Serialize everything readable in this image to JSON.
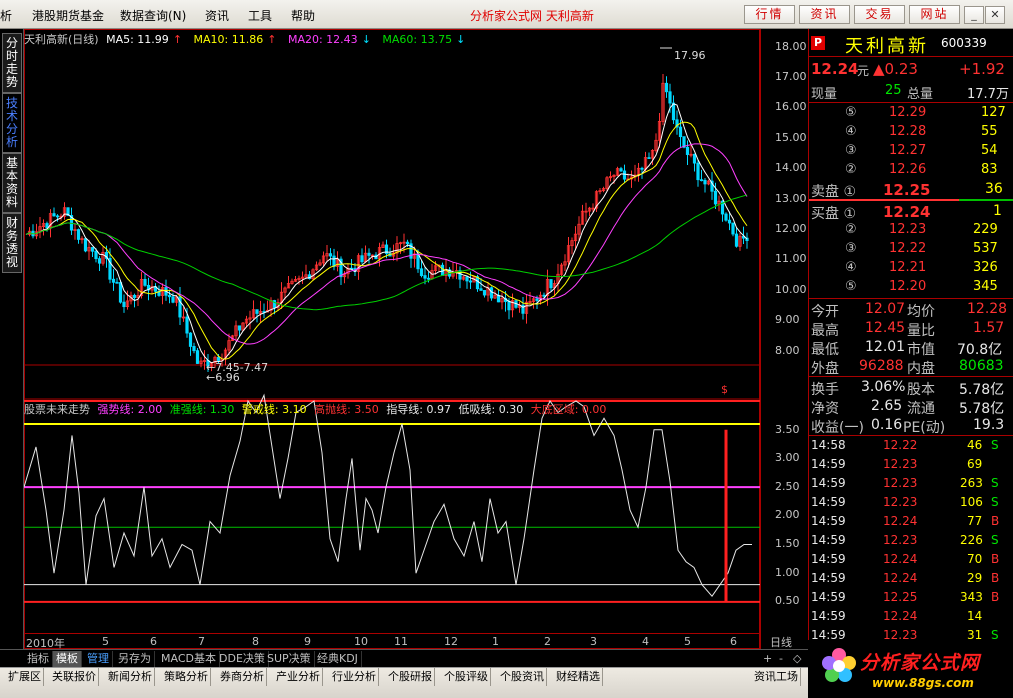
{
  "menu": {
    "items": [
      "析",
      "港股期货基金",
      "数据查询(N)",
      "资讯",
      "工具",
      "帮助"
    ],
    "center_title": "分析家公式网  天利高新",
    "right_buttons": [
      "行情",
      "资讯",
      "交易",
      "网站"
    ],
    "window_buttons": [
      "_",
      "▭",
      "✕"
    ]
  },
  "left_tabs": [
    {
      "label": "分时走势",
      "active": false
    },
    {
      "label": "技术分析",
      "active": true
    },
    {
      "label": "基本资料",
      "active": false
    },
    {
      "label": "财务透视",
      "active": false
    }
  ],
  "main_chart": {
    "title": "天利高新(日线)",
    "ma": [
      {
        "label": "MA5: 11.99",
        "arrow": "↑",
        "color": "#ffffff",
        "arrow_color": "#ff3232"
      },
      {
        "label": "MA10: 11.86",
        "arrow": "↑",
        "color": "#ffff00",
        "arrow_color": "#ff3232"
      },
      {
        "label": "MA20: 12.43",
        "arrow": "↓",
        "color": "#ff40ff",
        "arrow_color": "#00e0ff"
      },
      {
        "label": "MA60: 13.75",
        "arrow": "↓",
        "color": "#00e000",
        "arrow_color": "#00e0ff"
      }
    ],
    "annotations": {
      "high": "17.96",
      "low": "6.96",
      "range": "7.45-7.47"
    },
    "yaxis_ticks": [
      "18.00",
      "17.00",
      "16.00",
      "15.00",
      "14.00",
      "13.00",
      "12.00",
      "11.00",
      "10.00",
      "9.00",
      "8.00"
    ]
  },
  "indicator": {
    "title": "股票未来走势",
    "lines": [
      {
        "label": "强势线: 2.00",
        "color": "#ff40ff"
      },
      {
        "label": "准强线: 1.30",
        "color": "#00e000"
      },
      {
        "label": "警戒线: 3.10",
        "color": "#ffff00"
      },
      {
        "label": "高抛线: 3.50",
        "color": "#ff3232"
      },
      {
        "label": "指导线: 0.97",
        "color": "#e8e8e8"
      },
      {
        "label": "低吸线: 0.30",
        "color": "#e8e8e8"
      },
      {
        "label": "大底区域: 0.00",
        "color": "#ff3232"
      }
    ],
    "yaxis_ticks": [
      "3.50",
      "3.00",
      "2.50",
      "2.00",
      "1.50",
      "1.00",
      "0.50"
    ]
  },
  "xaxis": {
    "labels": [
      "2010年",
      "5",
      "6",
      "7",
      "8",
      "9",
      "10",
      "11",
      "12",
      "1",
      "2",
      "3",
      "4",
      "5",
      "6"
    ],
    "period": "日线"
  },
  "bottom_tabs": [
    {
      "label": "指标",
      "style": "normal"
    },
    {
      "label": "模板",
      "style": "active"
    },
    {
      "label": "管理",
      "style": "blue"
    },
    {
      "label": "另存为",
      "style": "normal"
    },
    {
      "label": "MACD基本",
      "style": "normal"
    },
    {
      "label": "DDE决策",
      "style": "normal"
    },
    {
      "label": "SUP决策",
      "style": "normal"
    },
    {
      "label": "经典KDJ",
      "style": "normal"
    }
  ],
  "status_tabs": [
    "扩展区",
    "关联报价",
    "新闻分析",
    "策略分析",
    "券商分析",
    "产业分析",
    "行业分析",
    "个股研报",
    "个股评级",
    "个股资讯",
    "财经精选",
    "资讯工场"
  ],
  "zoom_controls": [
    "+",
    "-",
    "◇"
  ],
  "stock": {
    "badge": "P",
    "name": "天利高新",
    "code": "600339",
    "price": "12.24",
    "price_unit": "元",
    "change": "▲0.23",
    "change_pct": "+1.92",
    "volume_now_label": "现量",
    "volume_now": "25",
    "volume_total_label": "总量",
    "volume_total": "17.7万",
    "asks": [
      {
        "level": "⑤",
        "price": "12.29",
        "vol": "127"
      },
      {
        "level": "④",
        "price": "12.28",
        "vol": "55"
      },
      {
        "level": "③",
        "price": "12.27",
        "vol": "54"
      },
      {
        "level": "②",
        "price": "12.26",
        "vol": "83"
      },
      {
        "level": "卖盘 ①",
        "price": "12.25",
        "vol": "36"
      }
    ],
    "bids": [
      {
        "level": "买盘 ①",
        "price": "12.24",
        "vol": "1"
      },
      {
        "level": "②",
        "price": "12.23",
        "vol": "229"
      },
      {
        "level": "③",
        "price": "12.22",
        "vol": "537"
      },
      {
        "level": "④",
        "price": "12.21",
        "vol": "326"
      },
      {
        "level": "⑤",
        "price": "12.20",
        "vol": "345"
      }
    ],
    "stats": [
      {
        "l1": "今开",
        "v1": "12.07",
        "c1": "red",
        "l2": "均价",
        "v2": "12.28",
        "c2": "red"
      },
      {
        "l1": "最高",
        "v1": "12.45",
        "c1": "red",
        "l2": "量比",
        "v2": "1.57",
        "c2": "red"
      },
      {
        "l1": "最低",
        "v1": "12.01",
        "c1": "white",
        "l2": "市值",
        "v2": "70.8亿",
        "c2": "white"
      },
      {
        "l1": "外盘",
        "v1": "96288",
        "c1": "red",
        "l2": "内盘",
        "v2": "80683",
        "c2": "green"
      }
    ],
    "fundamentals": [
      {
        "l1": "换手",
        "v1": "3.06%",
        "l2": "股本",
        "v2": "5.78亿"
      },
      {
        "l1": "净资",
        "v1": "2.65",
        "l2": "流通",
        "v2": "5.78亿"
      },
      {
        "l1": "收益(一)",
        "v1": "0.16",
        "l2": "PE(动)",
        "v2": "19.3"
      }
    ],
    "ticks": [
      {
        "time": "14:58",
        "price": "12.22",
        "vol": "46",
        "side": "S"
      },
      {
        "time": "14:59",
        "price": "12.23",
        "vol": "69",
        "side": ""
      },
      {
        "time": "14:59",
        "price": "12.23",
        "vol": "263",
        "side": "S"
      },
      {
        "time": "14:59",
        "price": "12.23",
        "vol": "106",
        "side": "S"
      },
      {
        "time": "14:59",
        "price": "12.24",
        "vol": "77",
        "side": "B"
      },
      {
        "time": "14:59",
        "price": "12.23",
        "vol": "226",
        "side": "S"
      },
      {
        "time": "14:59",
        "price": "12.24",
        "vol": "70",
        "side": "B"
      },
      {
        "time": "14:59",
        "price": "12.24",
        "vol": "29",
        "side": "B"
      },
      {
        "time": "14:59",
        "price": "12.25",
        "vol": "343",
        "side": "B"
      },
      {
        "time": "14:59",
        "price": "12.24",
        "vol": "14",
        "side": ""
      },
      {
        "time": "14:59",
        "price": "12.23",
        "vol": "31",
        "side": "S"
      },
      {
        "time": "14:59",
        "price": "12.24",
        "vol": "81",
        "side": "B"
      }
    ]
  },
  "logo": {
    "text": "分析家公式网",
    "url": "www.88gs.com"
  }
}
